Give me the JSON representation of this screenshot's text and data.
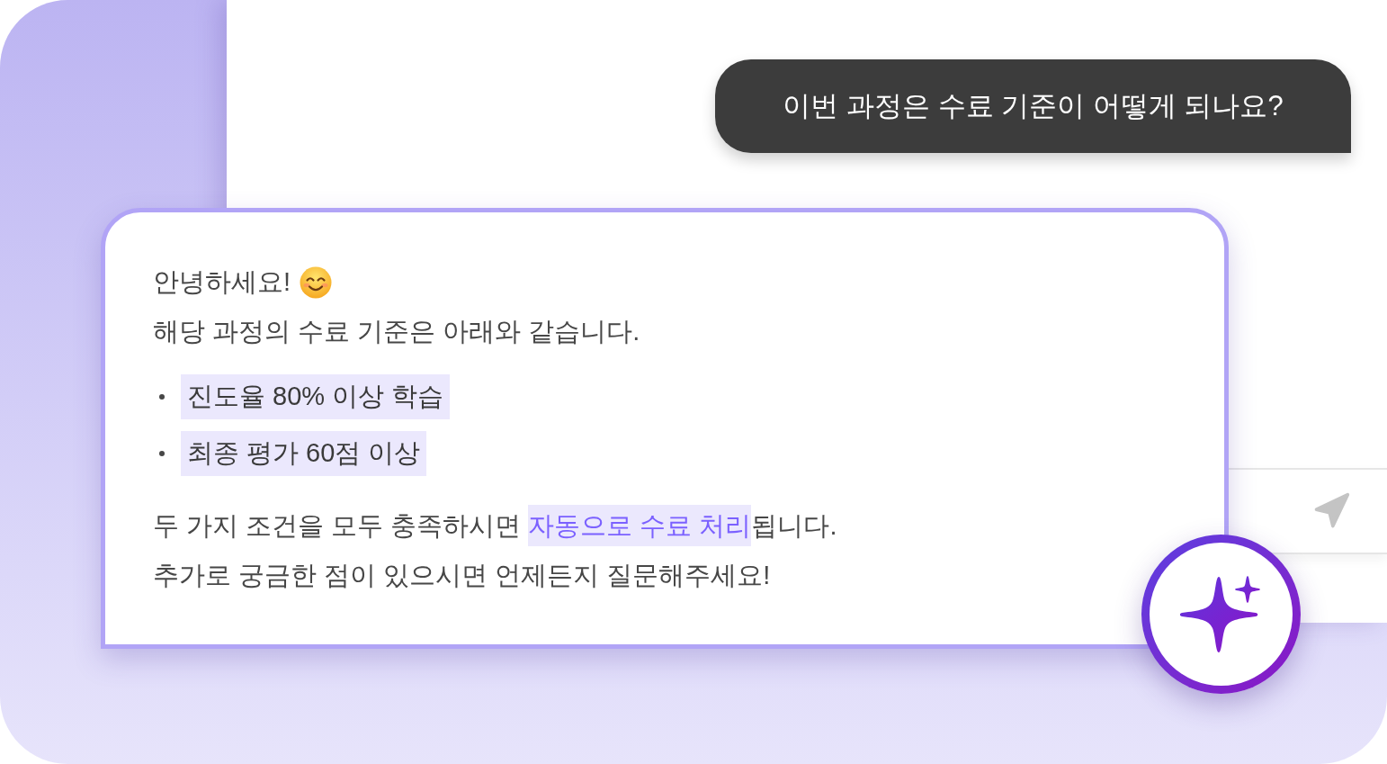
{
  "user_message": {
    "text": "이번 과정은 수료 기준이 어떻게 되나요?"
  },
  "answer": {
    "intro_lines": [
      "안녕하세요!",
      "해당 과정의 수료 기준은 아래와 같습니다."
    ],
    "criteria": [
      "진도율 80% 이상 학습",
      "최종 평가 60점 이상"
    ],
    "closing_lines": [
      {
        "segments": [
          {
            "text": "두 가지 조건을 모두 충족하시면 ",
            "highlighted": false
          },
          {
            "text": "자동으로 수료 처리",
            "highlighted": true
          },
          {
            "text": "됩니다.",
            "highlighted": false
          }
        ]
      },
      {
        "segments": [
          {
            "text": "추가로 궁금한 점이 있으시면 언제든지 질문해주세요!",
            "highlighted": false
          }
        ]
      }
    ]
  }
}
